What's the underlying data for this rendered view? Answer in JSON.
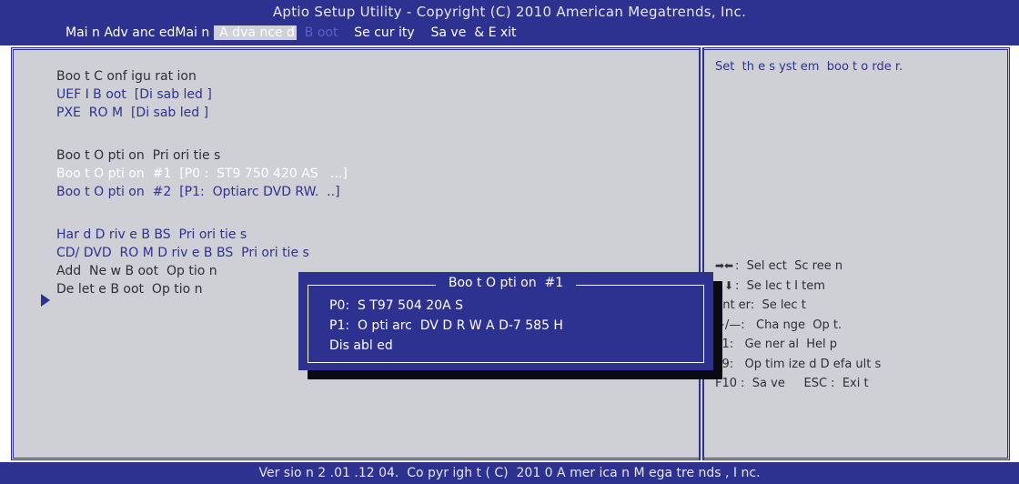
{
  "header": {
    "title": "Aptio Setup Utility - Copyright (C) 2010 American Megatrends, Inc.",
    "tabs": [
      {
        "label": "Mai n Adv anc edMai n ",
        "state": "normal"
      },
      {
        "label": " A dva nce d",
        "state": "active"
      },
      {
        "label": "  B oot ",
        "state": "dim"
      },
      {
        "label": "   Se cur ity",
        "state": "normal"
      },
      {
        "label": "    Sa ve  & E xit",
        "state": "normal"
      }
    ]
  },
  "left_panel": {
    "rows": [
      {
        "text": "Boo t C onf igu rat ion",
        "style": "hdr"
      },
      {
        "text": "UEF I B oot  [Di sab led ]",
        "style": "link"
      },
      {
        "text": "PXE  RO M  [Di sab led ]",
        "style": "link"
      },
      {
        "text": "",
        "style": "blank"
      },
      {
        "text": "Boo t O pti on  Pri ori tie s",
        "style": "hdr"
      },
      {
        "text": "Boo t O pti on  #1  [P0 :  ST9 750 420 AS   ...]",
        "style": "sel"
      },
      {
        "text": "Boo t O pti on  #2  [P1:  Optiarc DVD RW.  ..]",
        "style": "link"
      },
      {
        "text": "",
        "style": "blank"
      },
      {
        "text": "Har d D riv e B BS  Pri ori tie s",
        "style": "link"
      },
      {
        "text": "CD/ DVD  RO M D riv e B BS  Pri ori tie s",
        "style": "link"
      },
      {
        "text": "Add  Ne w B oot  Op tio n",
        "style": "hdr"
      },
      {
        "text": "De let e B oot  Op tio n",
        "style": "hdr"
      }
    ]
  },
  "help_text": "Set  th e s yst em  boo t o rde r.",
  "key_hints": [
    {
      "icon": "left-right-arrows-icon",
      "glyph": "➡⬅",
      "text": ":  Sel ect  Sc ree n"
    },
    {
      "icon": "up-down-arrows-icon",
      "glyph": "⬆⬇",
      "text": ":  Se lec t I tem"
    },
    {
      "icon": "",
      "glyph": "",
      "text": "Ent er:  Se lec t"
    },
    {
      "icon": "",
      "glyph": "",
      "text": "+/—:   Cha nge  Op t."
    },
    {
      "icon": "",
      "glyph": "",
      "text": "F1:   Ge ner al  Hel p"
    },
    {
      "icon": "",
      "glyph": "",
      "text": "F9:   Op tim ize d D efa ult s"
    },
    {
      "icon": "",
      "glyph": "",
      "text": "F10 :  Sa ve     ESC :  Exi t"
    }
  ],
  "popup": {
    "title": "Boo t O pti on  #1",
    "options": [
      "P0:  S T97 504 20A S",
      "P1:  O pti arc  DV D R W A D-7 585 H",
      "Dis abl ed"
    ]
  },
  "footer": "Ver sio n 2 .01 .12 04.  Co pyr igh t ( C)  201 0 A mer ica n M ega tre nds , I nc.",
  "colors": {
    "bios_blue": "#2d3190",
    "panel_gray": "#cfd0d6",
    "selected_text": "#ffffff"
  }
}
